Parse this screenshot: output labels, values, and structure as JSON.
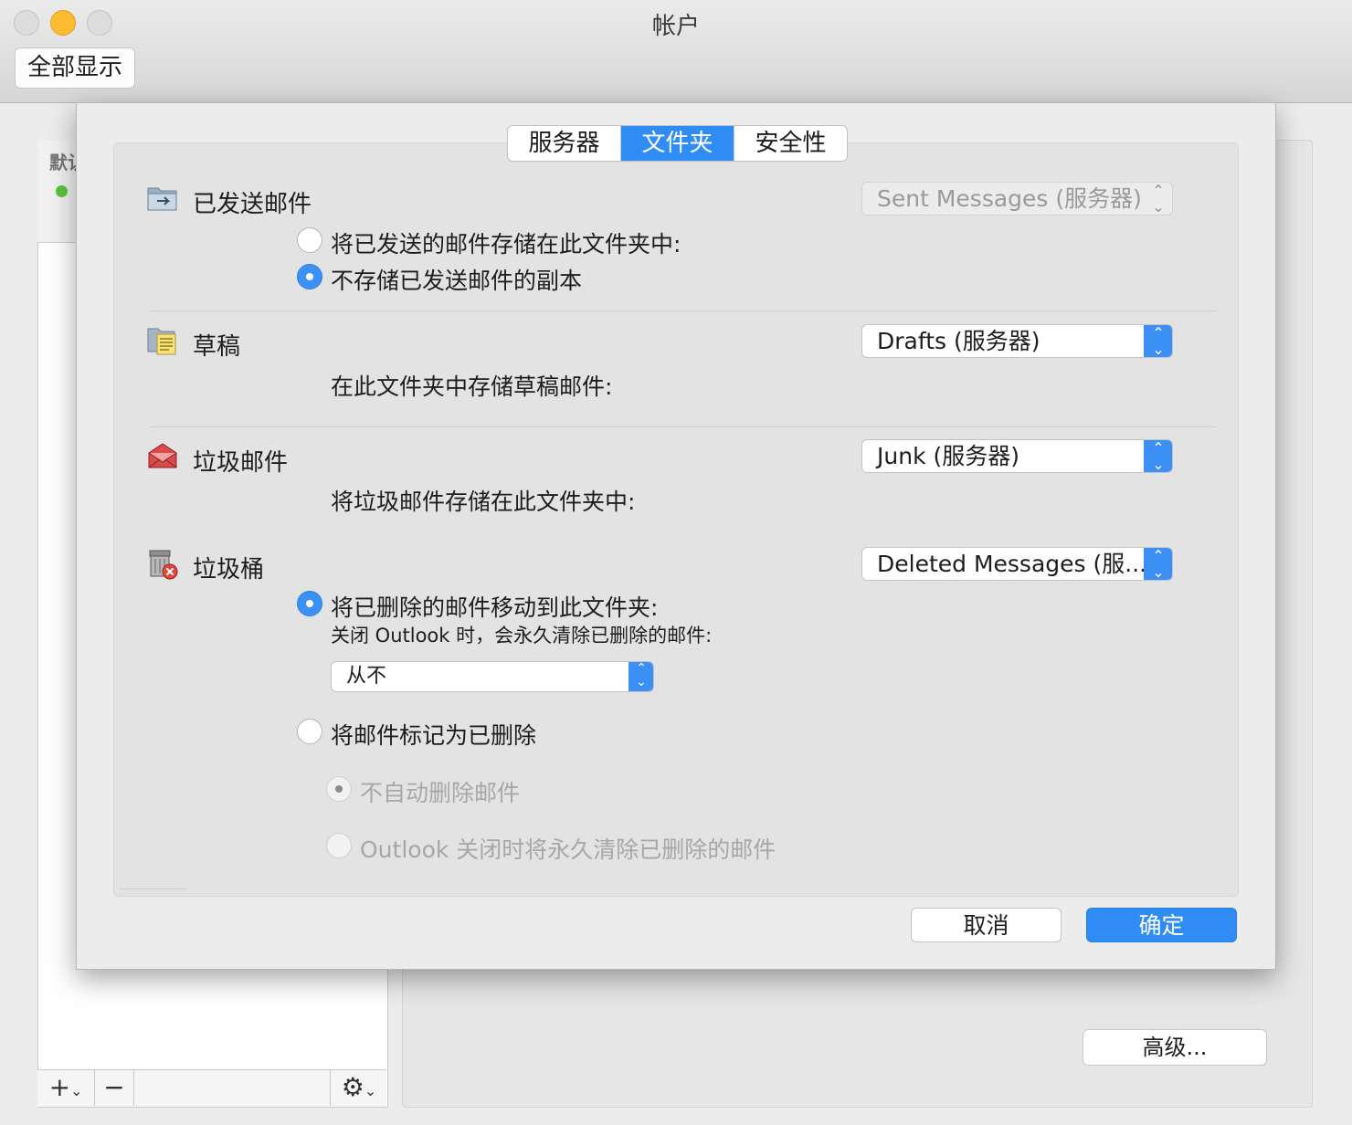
{
  "window": {
    "title": "帐户",
    "show_all": "全部显示"
  },
  "background": {
    "list_header": "默认",
    "bottombar": {
      "add": "+",
      "remove": "−",
      "gear": "⚙"
    },
    "advanced_button": "高级..."
  },
  "tabs": [
    {
      "label": "服务器",
      "active": false
    },
    {
      "label": "文件夹",
      "active": true
    },
    {
      "label": "安全性",
      "active": false
    }
  ],
  "sections": {
    "sent": {
      "title": "已发送邮件",
      "popup": "Sent Messages (服务器)",
      "options": [
        {
          "label": "将已发送的邮件存储在此文件夹中:",
          "selected": false
        },
        {
          "label": "不存储已发送邮件的副本",
          "selected": true
        }
      ]
    },
    "drafts": {
      "title": "草稿",
      "popup": "Drafts (服务器)",
      "description": "在此文件夹中存储草稿邮件:"
    },
    "junk": {
      "title": "垃圾邮件",
      "popup": "Junk (服务器)",
      "description": "将垃圾邮件存储在此文件夹中:"
    },
    "trash": {
      "title": "垃圾桶",
      "popup": "Deleted Messages (服...",
      "move_option": "将已删除的邮件移动到此文件夹:",
      "close_note": "关闭 Outlook 时，会永久清除已删除的邮件:",
      "purge_popup": "从不",
      "mark_option": "将邮件标记为已删除",
      "sub_options": [
        {
          "label": "不自动删除邮件",
          "selected": true
        },
        {
          "label": "Outlook 关闭时将永久清除已删除的邮件",
          "selected": false
        }
      ]
    }
  },
  "buttons": {
    "cancel": "取消",
    "ok": "确定"
  },
  "colors": {
    "accent": "#2f8cf5",
    "minimize": "#fbbc2f",
    "status_dot": "#5ac43b"
  }
}
